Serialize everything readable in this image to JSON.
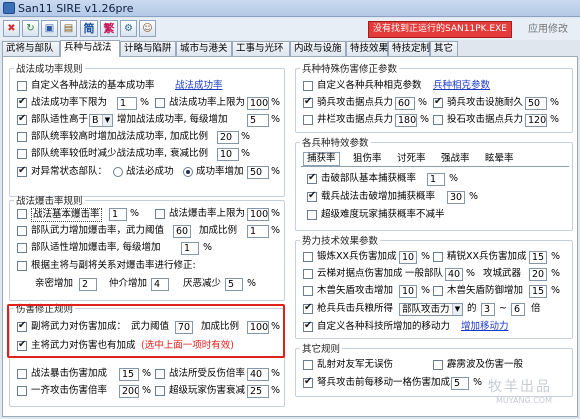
{
  "window": {
    "title": "San11 SIRE v1.26pre"
  },
  "toolbar": {
    "simplified": "简",
    "traditional": "繁",
    "status_message": "没有找到正运行的SAN11PK.EXE",
    "apply_label": "应用修改"
  },
  "tabs": [
    "武将与部队",
    "兵种与战法",
    "计略与陷阱",
    "城市与港关",
    "工事与光环",
    "内政与设施",
    "特技效果",
    "特技定制",
    "其它"
  ],
  "s1": {
    "legend": "战法成功率规则",
    "row1": "自定义各种战法的基本成功率",
    "row1_link": "战法成功率",
    "row2a": "战法成功率下限为",
    "row2a_val": "1",
    "row2_pct": "%",
    "row2b": "战法成功率上限为",
    "row2b_val": "100",
    "row2b_pct": "%",
    "row3a": "部队适性高于",
    "row3_sel": "B",
    "row3b": "增加战法成功率, 每级增加",
    "row3_val": "5",
    "row3_pct": "%",
    "row4": "部队统率较高时增加战法成功率, 加成比例",
    "row4_val": "20",
    "row4_pct": "%",
    "row5": "部队统率较低时减少战法成功率, 衰减比例",
    "row5_val": "10",
    "row5_pct": "%",
    "row6": "对异常状态部队：",
    "row6_opt1": "战法必成功",
    "row6_opt2": "成功率增加",
    "row6_val": "50",
    "row6_pct": "%"
  },
  "s2": {
    "legend": "战法爆击率规则",
    "row1": "战法基本爆击率",
    "row1_val": "1",
    "row1_pct": "%",
    "row1b": "战法爆击率上限为",
    "row1b_val": "100",
    "row1b_pct": "%",
    "row2": "部队武力增加爆击率，武力阈值",
    "row2_val": "60",
    "row2b": "加成比例",
    "row2b_val": "1",
    "row2b_pct": "%",
    "row3": "部队适性增加爆击率, 每级增加",
    "row3_val": "1",
    "row3_pct": "%",
    "row4": "根据主将与副将关系对爆击率进行修正:",
    "row5a": "亲密增加",
    "row5a_val": "2",
    "row5b": "仲介增加",
    "row5b_val": "4",
    "row5c": "厌恶减少",
    "row5c_val": "5",
    "row5_pct": "%"
  },
  "s3": {
    "legend": "伤害修正规则",
    "row1": "副将武力对伤害加成：",
    "row1b": "武力阈值",
    "row1_val": "70",
    "row1c": "加成比例",
    "row1c_val": "100",
    "row1_pct": "%",
    "row2": "主将武力对伤害也有加成",
    "row2_note": "(选中上面一项时有效)",
    "row3": "战法暴击伤害加成",
    "row3_val": "15",
    "row3_pct": "%",
    "row3b": "战法所受反伤倍率",
    "row3b_val": "40",
    "row3b_pct": "%",
    "row4": "一齐攻击伤害倍率",
    "row4_val": "200",
    "row4_pct": "%",
    "row4b": "超级玩家伤害衰减",
    "row4b_val": "25",
    "row4b_pct": "%"
  },
  "r1": {
    "legend": "兵种特殊伤害修正参数",
    "row1": "自定义各种兵种相克参数",
    "row1_link": "兵种相克参数",
    "row2": "骑兵攻击据点兵力",
    "row2_val": "60",
    "row2_pct": "%",
    "row2b": "骑兵攻击设施耐久",
    "row2b_val": "50",
    "row2b_pct": "%",
    "row3": "井栏攻击据点兵力",
    "row3_val": "180",
    "row3_pct": "%",
    "row3b": "投石攻击据点兵力",
    "row3b_val": "120",
    "row3b_pct": "%"
  },
  "r2": {
    "legend": "各兵种特效参数",
    "subtabs": [
      "捕获率",
      "狙伤率",
      "讨死率",
      "强战率",
      "眩晕率"
    ],
    "row1": "击破部队基本捕获概率",
    "row1_val": "1",
    "row1_pct": "%",
    "row2": "载兵战法击破增加捕获概率",
    "row2_val": "30",
    "row2_pct": "%",
    "row3": "超级难度玩家捕获概率不减半"
  },
  "r3": {
    "legend": "势力技术效果参数",
    "row1": "锻炼XX兵伤害加成",
    "row1_val": "10",
    "row1_pct": "%",
    "row1b": "精锐XX兵伤害加成",
    "row1b_val": "15",
    "row1b_pct": "%",
    "row2": "云梯对据点伤害加成",
    "row2b": "一般部队",
    "row2_val": "40",
    "row2_pct": "%",
    "row2c": "攻城武器",
    "row2c_val": "20",
    "row2c_pct": "%",
    "row3": "木兽矢盾攻击增加",
    "row3_val": "10",
    "row3_pct": "%",
    "row3b": "木兽矢盾防御增加",
    "row3b_val": "15",
    "row3b_pct": "%",
    "row4": "枪兵兵击兵粮所得",
    "row4_sel": "部队攻击力",
    "row4b": "的",
    "row4_val1": "3",
    "row4_dash": "~",
    "row4_val2": "6",
    "row4c": "倍",
    "row5": "自定义各种科技所增加的移动力",
    "row5_link": "增加移动力"
  },
  "r4": {
    "legend": "其它规则",
    "row1": "乱射对友军无误伤",
    "row1b": "霹雳波及伤害一般",
    "row2": "弩兵攻击前每移动一格伤害加成",
    "row2_val": "5",
    "row2_pct": "%"
  },
  "watermark": {
    "line1": "牧羊出品",
    "line2": "MUYANG.COM"
  }
}
